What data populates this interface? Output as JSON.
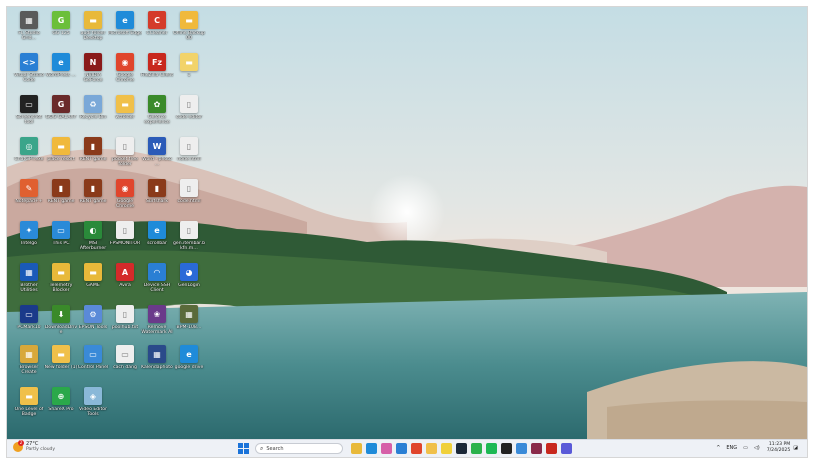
{
  "desktop": {
    "icons": [
      {
        "label": "FL Studio Grid…",
        "color": "#5a5a5a",
        "glyph": "▦"
      },
      {
        "label": "GG 125",
        "color": "#6bbf3a",
        "glyph": "G"
      },
      {
        "label": "audi folder Desktop",
        "color": "#e8b93a",
        "glyph": "▬"
      },
      {
        "label": "Microsoft Edge",
        "color": "#1f8bd9",
        "glyph": "e"
      },
      {
        "label": "CCleaner",
        "color": "#d43b2a",
        "glyph": "C"
      },
      {
        "label": "Ofline Backup 00",
        "color": "#f0b93c",
        "glyph": "▬"
      },
      {
        "label": "Visual Studio Code",
        "color": "#2a7fd4",
        "glyph": "<>"
      },
      {
        "label": "WordPress …",
        "color": "#1f8bd9",
        "glyph": "e"
      },
      {
        "label": "NVIDIA GeForce",
        "color": "#8a1a1a",
        "glyph": "N"
      },
      {
        "label": "Google Chrome",
        "color": "#e0452c",
        "glyph": "◉"
      },
      {
        "label": "FileZilla Client",
        "color": "#c8281e",
        "glyph": "Fz"
      },
      {
        "label": "1",
        "color": "#f2d36a",
        "glyph": "▬"
      },
      {
        "label": "Screenshot tool",
        "color": "#222222",
        "glyph": "▭"
      },
      {
        "label": "GOG GALAXY",
        "color": "#6a2a2a",
        "glyph": "G"
      },
      {
        "label": "Recycle Bin",
        "color": "#7aa8d8",
        "glyph": "♻"
      },
      {
        "label": "wtfolder",
        "color": "#f0c04a",
        "glyph": "▬"
      },
      {
        "label": "Geforce experience",
        "color": "#3a8a2a",
        "glyph": "✿"
      },
      {
        "label": "code editor",
        "color": "#eeeeee",
        "glyph": "▯"
      },
      {
        "label": "ChatGPT.exe",
        "color": "#3aa58a",
        "glyph": "◎"
      },
      {
        "label": "place resort",
        "color": "#f0b93c",
        "glyph": "▬"
      },
      {
        "label": "RENT game",
        "color": "#8a3a1a",
        "glyph": "▮"
      },
      {
        "label": "pocket free folder",
        "color": "#eeeeee",
        "glyph": "▯"
      },
      {
        "label": "Word - photo …",
        "color": "#2b5bb8",
        "glyph": "W"
      },
      {
        "label": "node.html",
        "color": "#eeeeee",
        "glyph": "▯"
      },
      {
        "label": "Notepad++",
        "color": "#e06030",
        "glyph": "✎"
      },
      {
        "label": "RENT game",
        "color": "#8a3a1a",
        "glyph": "▮"
      },
      {
        "label": "RENT game",
        "color": "#8a3a1a",
        "glyph": "▮"
      },
      {
        "label": "Google Chrome",
        "color": "#e0452c",
        "glyph": "◉"
      },
      {
        "label": "Surfshark",
        "color": "#8a3a1a",
        "glyph": "▮"
      },
      {
        "label": "code.html",
        "color": "#eeeeee",
        "glyph": "▯"
      },
      {
        "label": "Intelgo",
        "color": "#2a8ad8",
        "glyph": "✦"
      },
      {
        "label": "This PC",
        "color": "#2a8ad8",
        "glyph": "▭"
      },
      {
        "label": "MSI Afterburner",
        "color": "#2a8a3a",
        "glyph": "◐"
      },
      {
        "label": "FPSMONITOR",
        "color": "#eeeeee",
        "glyph": "▯"
      },
      {
        "label": "scrollbar",
        "color": "#1f8bd9",
        "glyph": "e"
      },
      {
        "label": "gen.itembar.bkfn.m…",
        "color": "#eeeeee",
        "glyph": "▯"
      },
      {
        "label": "Brother Utilities",
        "color": "#1a5ab8",
        "glyph": "▦"
      },
      {
        "label": "Telemetry Blocker",
        "color": "#e8b93a",
        "glyph": "▬"
      },
      {
        "label": "GAME",
        "color": "#e8b93a",
        "glyph": "▬"
      },
      {
        "label": "Avira",
        "color": "#d42a2a",
        "glyph": "A"
      },
      {
        "label": "Device SSH Client",
        "color": "#2a7fd4",
        "glyph": "◠"
      },
      {
        "label": "GenLogin",
        "color": "#2a6ad8",
        "glyph": "◕"
      },
      {
        "label": "PCMark10",
        "color": "#1a3a8a",
        "glyph": "▭"
      },
      {
        "label": "DownloadDrive",
        "color": "#3a8a2a",
        "glyph": "⬇"
      },
      {
        "label": "EPSON Tools",
        "color": "#5a8ad8",
        "glyph": "⚙"
      },
      {
        "label": "poolhub.txt",
        "color": "#eeeeee",
        "glyph": "▯"
      },
      {
        "label": "Remove Watermark AI",
        "color": "#6a3a8a",
        "glyph": "❀"
      },
      {
        "label": "BPM-108…",
        "color": "#5a6a3a",
        "glyph": "▦"
      },
      {
        "label": "Browser Create",
        "color": "#d8a83a",
        "glyph": "▦"
      },
      {
        "label": "New folder (1)",
        "color": "#f0c04a",
        "glyph": "▬"
      },
      {
        "label": "Control Panel",
        "color": "#3a8ad8",
        "glyph": "▭"
      },
      {
        "label": "cach dang",
        "color": "#eeeeee",
        "glyph": "▭"
      },
      {
        "label": "Kalendaphoto",
        "color": "#2a4a8a",
        "glyph": "▦"
      },
      {
        "label": "google drive",
        "color": "#1f8bd9",
        "glyph": "e"
      },
      {
        "label": "One Level of Badge",
        "color": "#f0c04a",
        "glyph": "▬"
      },
      {
        "label": "ShareX Pro",
        "color": "#2aa84a",
        "glyph": "⊕"
      },
      {
        "label": "Video Editor Tools",
        "color": "#8ab8d8",
        "glyph": "◈"
      }
    ]
  },
  "taskbar": {
    "weather": {
      "temp": "27°C",
      "condition": "Partly cloudy",
      "badge": "2"
    },
    "search_placeholder": "Search",
    "apps": [
      "file-explorer",
      "edge",
      "copilot",
      "store",
      "chrome",
      "notes",
      "sticky",
      "steam",
      "whatsapp",
      "spotify",
      "capcut",
      "app",
      "winrar",
      "filezilla",
      "teams"
    ],
    "tray": {
      "chevron": "^",
      "lang": "ENG",
      "time": "11:23 PM",
      "date": "7/24/2025"
    }
  }
}
